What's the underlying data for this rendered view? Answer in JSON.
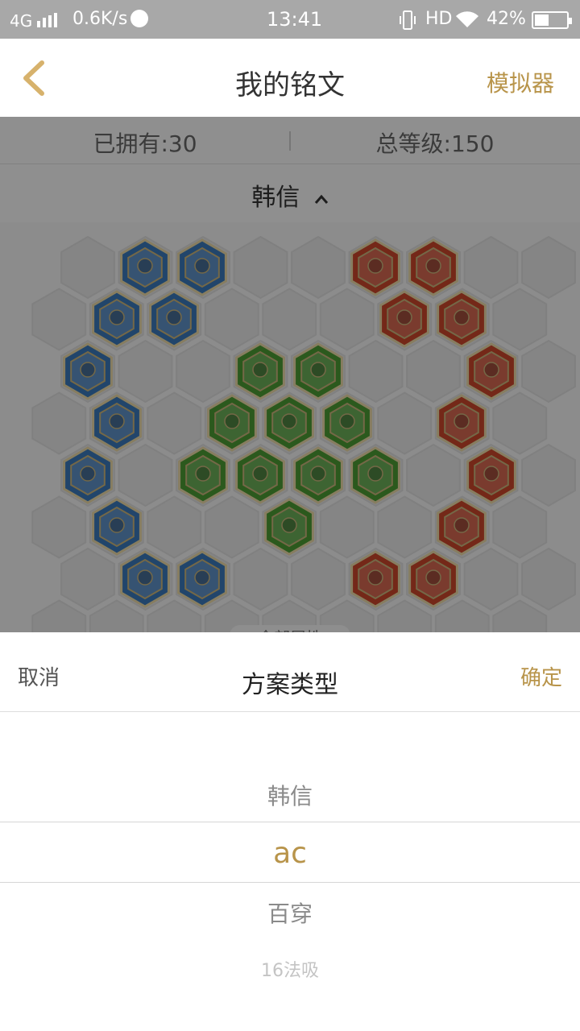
{
  "status_bar": {
    "network": "4G",
    "speed": "0.6K/s",
    "time": "13:41",
    "hd": "HD",
    "battery": "42%"
  },
  "nav": {
    "back_icon": "chevron-left-icon",
    "title": "我的铭文",
    "action": "模拟器"
  },
  "stats": {
    "owned": "已拥有:30",
    "total_level": "总等级:150"
  },
  "hero": {
    "name": "韩信",
    "toggle_icon": "chevron-up-icon"
  },
  "rune_board": {
    "colors": {
      "blue": "#3a78b8",
      "green": "#4a9a32",
      "red": "#c8462a",
      "empty": "#e6e6e6"
    }
  },
  "all_attributes_tab": "全部属性",
  "picker": {
    "cancel": "取消",
    "title": "方案类型",
    "confirm": "确定",
    "options": [
      "韩信",
      "ac",
      "百穿",
      "16法吸"
    ],
    "selected_index": 1
  },
  "colors": {
    "accent": "#b8944a"
  }
}
